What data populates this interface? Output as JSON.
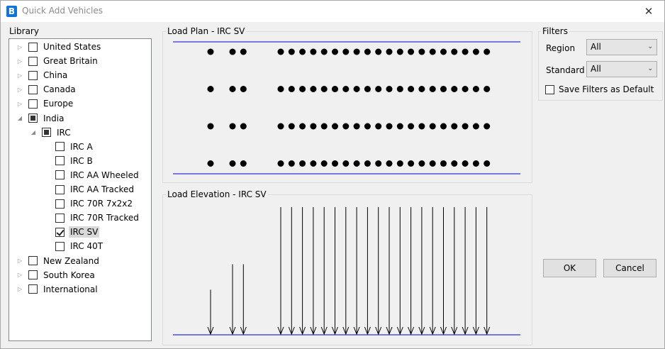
{
  "window": {
    "title": "Quick Add Vehicles",
    "app_icon_letter": "B",
    "close_glyph": "✕"
  },
  "library": {
    "label": "Library",
    "items": [
      {
        "label": "United States",
        "level": 0,
        "expander": "▷",
        "state": "unchecked"
      },
      {
        "label": "Great Britain",
        "level": 0,
        "expander": "▷",
        "state": "unchecked"
      },
      {
        "label": "China",
        "level": 0,
        "expander": "▷",
        "state": "unchecked"
      },
      {
        "label": "Canada",
        "level": 0,
        "expander": "▷",
        "state": "unchecked"
      },
      {
        "label": "Europe",
        "level": 0,
        "expander": "▷",
        "state": "unchecked"
      },
      {
        "label": "India",
        "level": 0,
        "expander": "◢",
        "state": "partial"
      },
      {
        "label": "IRC",
        "level": 1,
        "expander": "◢",
        "state": "partial"
      },
      {
        "label": "IRC A",
        "level": 2,
        "expander": "",
        "state": "unchecked"
      },
      {
        "label": "IRC B",
        "level": 2,
        "expander": "",
        "state": "unchecked"
      },
      {
        "label": "IRC AA Wheeled",
        "level": 2,
        "expander": "",
        "state": "unchecked"
      },
      {
        "label": "IRC AA Tracked",
        "level": 2,
        "expander": "",
        "state": "unchecked"
      },
      {
        "label": "IRC 70R 7x2x2",
        "level": 2,
        "expander": "",
        "state": "unchecked"
      },
      {
        "label": "IRC 70R Tracked",
        "level": 2,
        "expander": "",
        "state": "unchecked"
      },
      {
        "label": "IRC SV",
        "level": 2,
        "expander": "",
        "state": "checked",
        "selected": true
      },
      {
        "label": "IRC 40T",
        "level": 2,
        "expander": "",
        "state": "unchecked"
      },
      {
        "label": "New Zealand",
        "level": 0,
        "expander": "▷",
        "state": "unchecked"
      },
      {
        "label": "South Korea",
        "level": 0,
        "expander": "▷",
        "state": "unchecked"
      },
      {
        "label": "International",
        "level": 0,
        "expander": "▷",
        "state": "unchecked"
      }
    ]
  },
  "load_plan": {
    "label": "Load Plan - IRC SV",
    "line_color": "#0000cc",
    "wheel_rows": 4,
    "axle_groups": [
      1,
      2,
      20
    ]
  },
  "load_elevation": {
    "label": "Load Elevation - IRC SV",
    "line_color": "#0000cc",
    "arrow_relative_heights": [
      0.35,
      0.55,
      0.55,
      1,
      1,
      1,
      1,
      1,
      1,
      1,
      1,
      1,
      1,
      1,
      1,
      1,
      1,
      1,
      1,
      1,
      1,
      1,
      1
    ]
  },
  "filters": {
    "label": "Filters",
    "region_label": "Region",
    "region_value": "All",
    "standard_label": "Standard",
    "standard_value": "All",
    "save_default_label": "Save Filters as Default",
    "save_default_checked": false,
    "dropdown_glyph": "⌄"
  },
  "buttons": {
    "ok": "OK",
    "cancel": "Cancel"
  }
}
